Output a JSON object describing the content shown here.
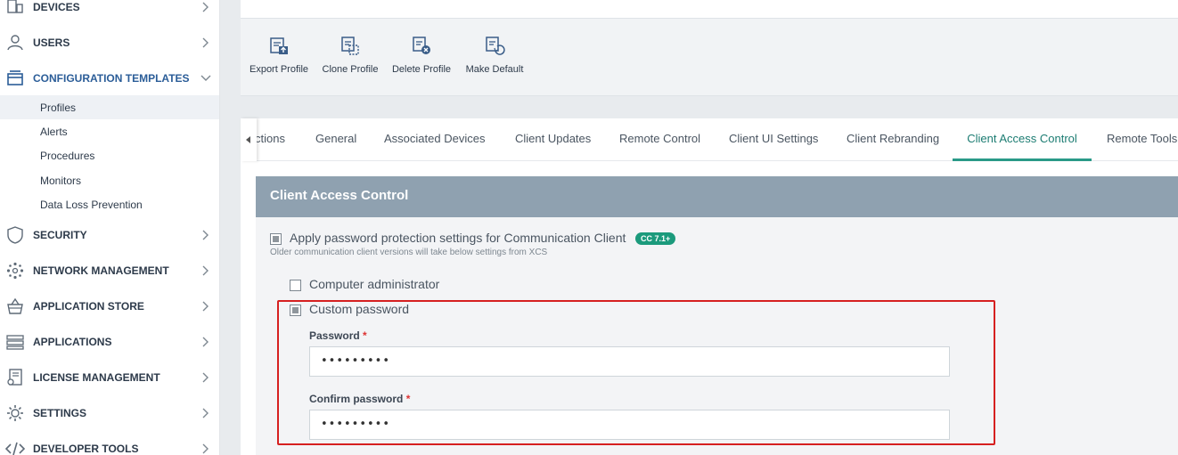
{
  "sidebar": {
    "items": [
      {
        "id": "devices",
        "label": "DEVICES",
        "icon": "devices-icon"
      },
      {
        "id": "users",
        "label": "USERS",
        "icon": "user-icon"
      },
      {
        "id": "configuration-templates",
        "label": "CONFIGURATION TEMPLATES",
        "icon": "template-icon",
        "expanded": true
      },
      {
        "id": "security",
        "label": "SECURITY",
        "icon": "shield-icon"
      },
      {
        "id": "network-management",
        "label": "NETWORK MANAGEMENT",
        "icon": "network-icon"
      },
      {
        "id": "application-store",
        "label": "APPLICATION STORE",
        "icon": "basket-icon"
      },
      {
        "id": "applications",
        "label": "APPLICATIONS",
        "icon": "applications-icon"
      },
      {
        "id": "license-management",
        "label": "LICENSE MANAGEMENT",
        "icon": "license-icon"
      },
      {
        "id": "settings",
        "label": "SETTINGS",
        "icon": "gear-icon"
      },
      {
        "id": "developer-tools",
        "label": "DEVELOPER TOOLS",
        "icon": "code-icon"
      }
    ],
    "subitems": [
      {
        "label": "Profiles",
        "selected": true
      },
      {
        "label": "Alerts"
      },
      {
        "label": "Procedures"
      },
      {
        "label": "Monitors"
      },
      {
        "label": "Data Loss Prevention"
      }
    ]
  },
  "toolbar": {
    "buttons": [
      {
        "label": "Export Profile",
        "icon": "export-profile-icon"
      },
      {
        "label": "Clone Profile",
        "icon": "clone-profile-icon"
      },
      {
        "label": "Delete Profile",
        "icon": "delete-profile-icon"
      },
      {
        "label": "Make Default",
        "icon": "make-default-icon"
      }
    ]
  },
  "tabs": [
    {
      "label": "ctions"
    },
    {
      "label": "General"
    },
    {
      "label": "Associated Devices"
    },
    {
      "label": "Client Updates"
    },
    {
      "label": "Remote Control"
    },
    {
      "label": "Client UI Settings"
    },
    {
      "label": "Client Rebranding"
    },
    {
      "label": "Client Access Control",
      "active": true
    },
    {
      "label": "Remote Tools"
    }
  ],
  "panel": {
    "title": "Client Access Control",
    "apply_label": "Apply password protection settings for Communication Client",
    "badge": "CC 7.1+",
    "hint": "Older communication client versions will take below settings from XCS",
    "computer_admin_label": "Computer administrator",
    "custom_password_label": "Custom password",
    "password_label": "Password",
    "password_value": "•••••••••",
    "confirm_label": "Confirm password",
    "confirm_value": "•••••••••",
    "required_mark": "*"
  },
  "colors": {
    "accent": "#2a9a88",
    "header": "#8fa1b0",
    "highlight": "#d62020",
    "nav_active": "#2b5d98"
  }
}
